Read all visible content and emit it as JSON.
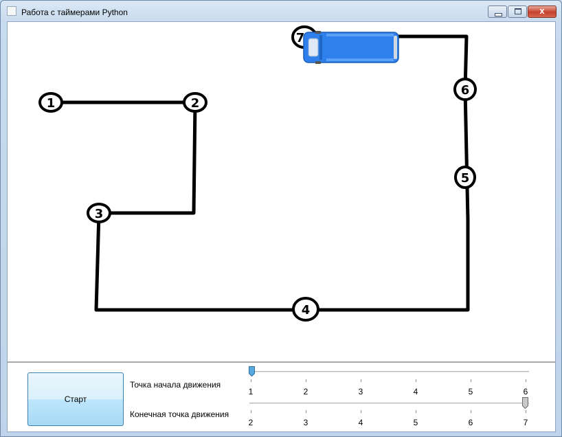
{
  "window": {
    "title": "Работа с таймерами Python",
    "buttons": [
      "minimize",
      "maximize",
      "close"
    ],
    "close_glyph": "x"
  },
  "route": {
    "points": [
      {
        "label": "1"
      },
      {
        "label": "2"
      },
      {
        "label": "3"
      },
      {
        "label": "4"
      },
      {
        "label": "5"
      },
      {
        "label": "6"
      },
      {
        "label": "7"
      }
    ],
    "vehicle": "minibus-icon",
    "vehicle_color": "#2f80ed"
  },
  "controls": {
    "start_button": "Старт",
    "start_slider": {
      "label": "Точка начала движения",
      "ticks": [
        "1",
        "2",
        "3",
        "4",
        "5",
        "6"
      ],
      "value": "1",
      "thumb_color": "#5aa9dd"
    },
    "end_slider": {
      "label": "Конечная точка движения",
      "ticks": [
        "2",
        "3",
        "4",
        "5",
        "6",
        "7"
      ],
      "value": "7",
      "thumb_color": "#c8c8c8"
    }
  }
}
